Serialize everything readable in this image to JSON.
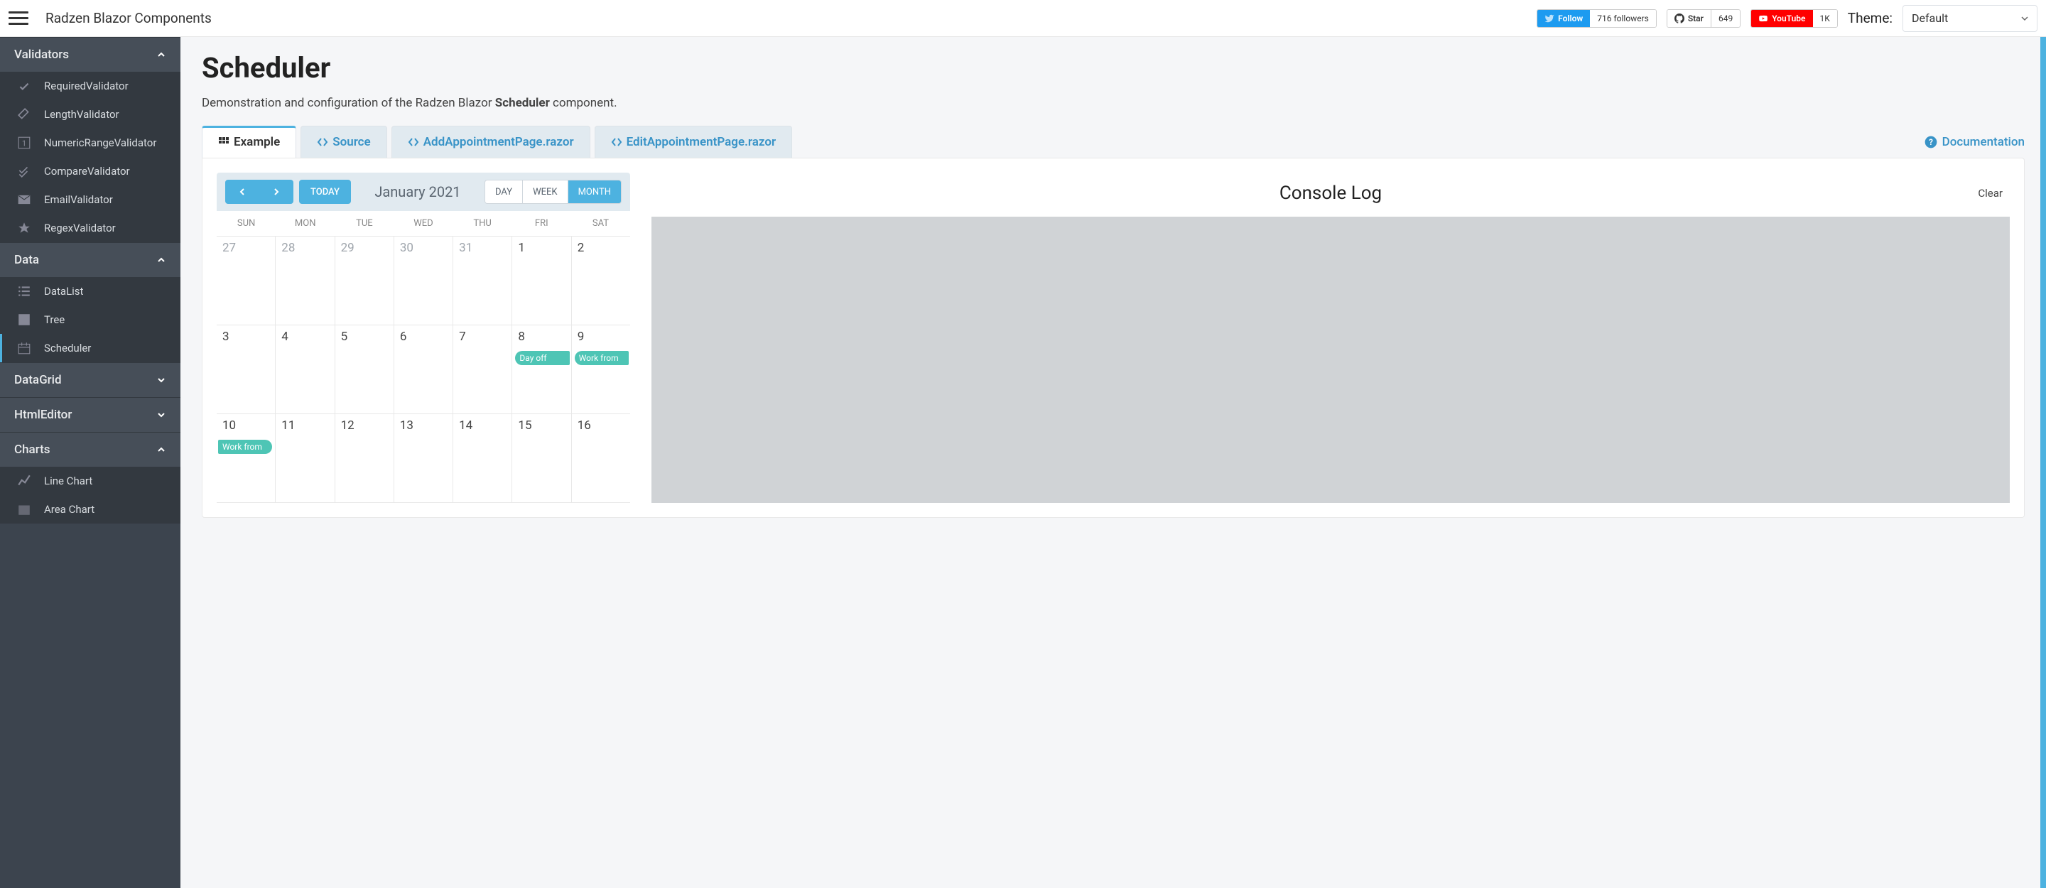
{
  "brand": "Radzen Blazor Components",
  "social": {
    "twitter": {
      "label": "Follow",
      "count": "716 followers"
    },
    "github": {
      "label": "Star",
      "count": "649"
    },
    "youtube": {
      "label": "YouTube",
      "count": "1K"
    }
  },
  "theme": {
    "label": "Theme:",
    "value": "Default"
  },
  "sidebar": {
    "sections": [
      {
        "label": "Validators",
        "expanded": true,
        "items": [
          {
            "label": "RequiredValidator"
          },
          {
            "label": "LengthValidator"
          },
          {
            "label": "NumericRangeValidator"
          },
          {
            "label": "CompareValidator"
          },
          {
            "label": "EmailValidator"
          },
          {
            "label": "RegexValidator"
          }
        ]
      },
      {
        "label": "Data",
        "expanded": true,
        "items": [
          {
            "label": "DataList"
          },
          {
            "label": "Tree"
          },
          {
            "label": "Scheduler",
            "active": true
          }
        ]
      },
      {
        "label": "DataGrid",
        "expanded": false
      },
      {
        "label": "HtmlEditor",
        "expanded": false
      },
      {
        "label": "Charts",
        "expanded": true,
        "items": [
          {
            "label": "Line Chart"
          },
          {
            "label": "Area Chart"
          }
        ]
      }
    ]
  },
  "page": {
    "title": "Scheduler",
    "desc_pre": "Demonstration and configuration of the Radzen Blazor ",
    "desc_bold": "Scheduler",
    "desc_post": " component."
  },
  "tabs": [
    {
      "label": "Example",
      "active": true
    },
    {
      "label": "Source"
    },
    {
      "label": "AddAppointmentPage.razor"
    },
    {
      "label": "EditAppointmentPage.razor"
    }
  ],
  "doc_link": "Documentation",
  "scheduler": {
    "today": "TODAY",
    "title": "January 2021",
    "views": [
      {
        "label": "DAY"
      },
      {
        "label": "WEEK"
      },
      {
        "label": "MONTH",
        "active": true
      }
    ],
    "days": [
      "SUN",
      "MON",
      "TUE",
      "WED",
      "THU",
      "FRI",
      "SAT"
    ],
    "rows": [
      [
        {
          "d": "27",
          "muted": true
        },
        {
          "d": "28",
          "muted": true
        },
        {
          "d": "29",
          "muted": true
        },
        {
          "d": "30",
          "muted": true
        },
        {
          "d": "31",
          "muted": true
        },
        {
          "d": "1"
        },
        {
          "d": "2"
        }
      ],
      [
        {
          "d": "3"
        },
        {
          "d": "4"
        },
        {
          "d": "5"
        },
        {
          "d": "6"
        },
        {
          "d": "7"
        },
        {
          "d": "8",
          "event": "Day off",
          "evclass": "start"
        },
        {
          "d": "9",
          "event": "Work from",
          "evclass": "start"
        }
      ],
      [
        {
          "d": "10",
          "event": "Work from",
          "evclass": "end"
        },
        {
          "d": "11"
        },
        {
          "d": "12"
        },
        {
          "d": "13"
        },
        {
          "d": "14"
        },
        {
          "d": "15"
        },
        {
          "d": "16"
        }
      ]
    ]
  },
  "console": {
    "title": "Console Log",
    "clear": "Clear"
  }
}
